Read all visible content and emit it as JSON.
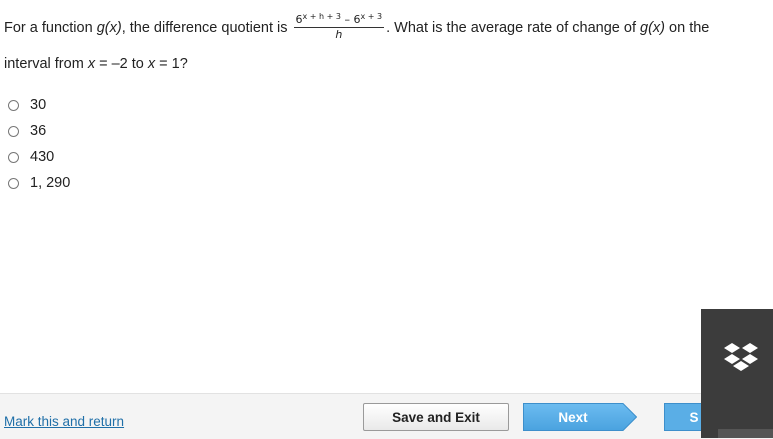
{
  "question": {
    "text_before": "For a function",
    "fn_name": "g(x)",
    "text_mid": ", the difference quotient is",
    "fraction_num_base1": "6",
    "fraction_num_exp1": "x + h + 3",
    "fraction_num_minus": " – ",
    "fraction_num_base2": "6",
    "fraction_num_exp2": "x + 3",
    "fraction_den": "h",
    "text_after": ". What is the average rate of change of",
    "fn_name2": "g(x)",
    "text_after2": "on the",
    "line2_before": "interval from",
    "var1": "x",
    "eq1": " = –2 to ",
    "var2": "x",
    "eq2": " = 1?"
  },
  "options": [
    {
      "label": "30"
    },
    {
      "label": "36"
    },
    {
      "label": "430"
    },
    {
      "label": "1, 290"
    }
  ],
  "footer": {
    "mark_link": "Mark this and return",
    "save_exit": "Save and Exit",
    "next": "Next",
    "submit": "S"
  },
  "icons": {
    "dropbox": "dropbox-icon",
    "next_arrow": "arrow-shape"
  },
  "colors": {
    "next_button": "#5aaee6",
    "link": "#1f6fa8",
    "side_panel": "#3c3c3c"
  }
}
